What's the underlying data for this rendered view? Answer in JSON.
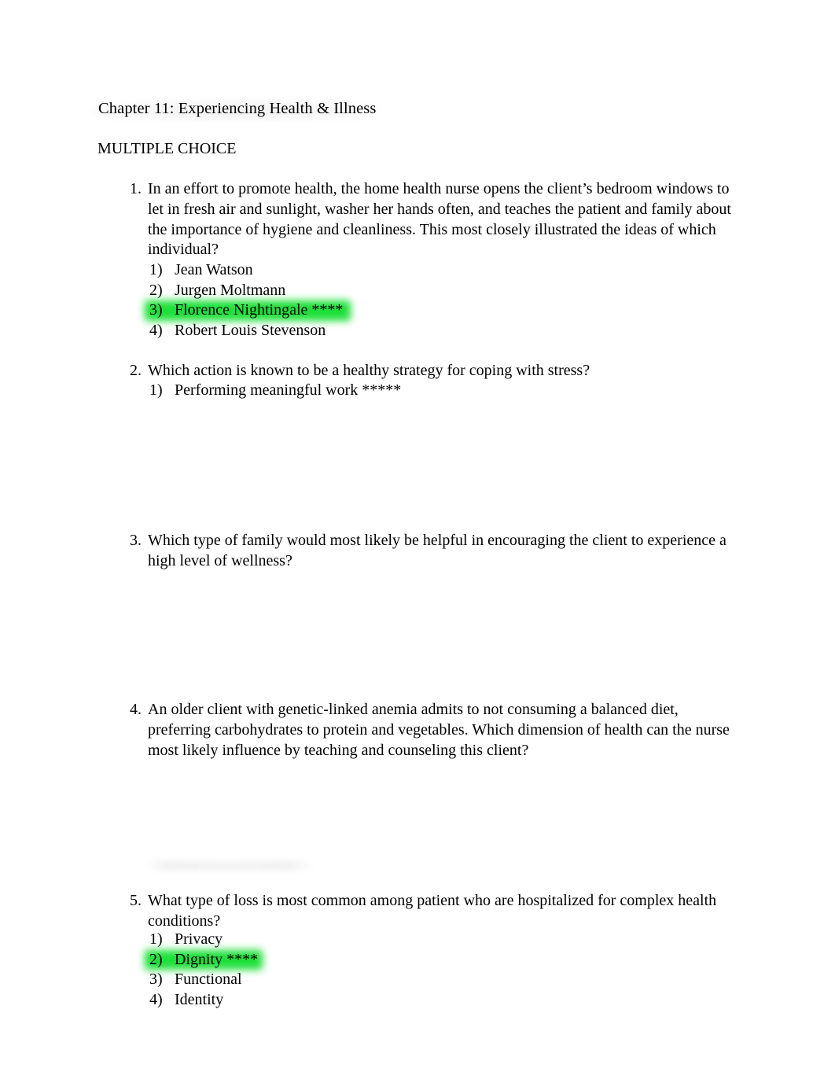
{
  "document": {
    "title": "Chapter 11: Experiencing Health & Illness",
    "section_heading": "MULTIPLE CHOICE",
    "highlight_color": "#1ee03a",
    "text_color": "#000000",
    "background_color": "#ffffff"
  },
  "questions": [
    {
      "number": "1.",
      "stem": "In an effort to promote health, the home health nurse opens the client’s bedroom windows to let in fresh air and sunlight, washer her hands often, and teaches the patient and family about the importance of hygiene and cleanliness. This most closely illustrated the ideas of which individual?",
      "options": [
        {
          "marker": "1)",
          "text": "Jean Watson",
          "highlighted": false,
          "highlight_width": 0
        },
        {
          "marker": "2)",
          "text": "Jurgen Moltmann",
          "highlighted": false,
          "highlight_width": 0
        },
        {
          "marker": "3)",
          "text": "Florence Nightingale ****",
          "highlighted": true,
          "highlight_width": 262
        },
        {
          "marker": "4)",
          "text": "Robert Louis Stevenson",
          "highlighted": false,
          "highlight_width": 0
        }
      ]
    },
    {
      "number": "2.",
      "stem": "Which action is known to be a healthy strategy for coping with stress?",
      "options": [
        {
          "marker": "1)",
          "text": "Performing meaningful work *****",
          "highlighted": false,
          "highlight_width": 0
        }
      ]
    },
    {
      "number": "3.",
      "stem": "Which type of family would most likely be helpful in encouraging the client to experience a high level of wellness?",
      "options": []
    },
    {
      "number": "4.",
      "stem": "An older client with genetic-linked anemia admits to not consuming a balanced diet, preferring carbohydrates to protein and vegetables. Which dimension of health can the nurse most likely influence by teaching and counseling this client?",
      "options": []
    },
    {
      "number": "5.",
      "stem": "What type of loss is most common among patient who are hospitalized for complex health conditions?",
      "options": [
        {
          "marker": "1)",
          "text": "Privacy",
          "highlighted": false,
          "highlight_width": 0
        },
        {
          "marker": "2)",
          "text": "Dignity ****",
          "highlighted": true,
          "highlight_width": 150
        },
        {
          "marker": "3)",
          "text": "Functional",
          "highlighted": false,
          "highlight_width": 0
        },
        {
          "marker": "4)",
          "text": "Identity",
          "highlighted": false,
          "highlight_width": 0
        }
      ]
    }
  ],
  "layout": {
    "question_tops": [
      228,
      459,
      675,
      890,
      1133
    ],
    "option_tops": [
      331,
      484,
      0,
      0,
      1182
    ]
  }
}
